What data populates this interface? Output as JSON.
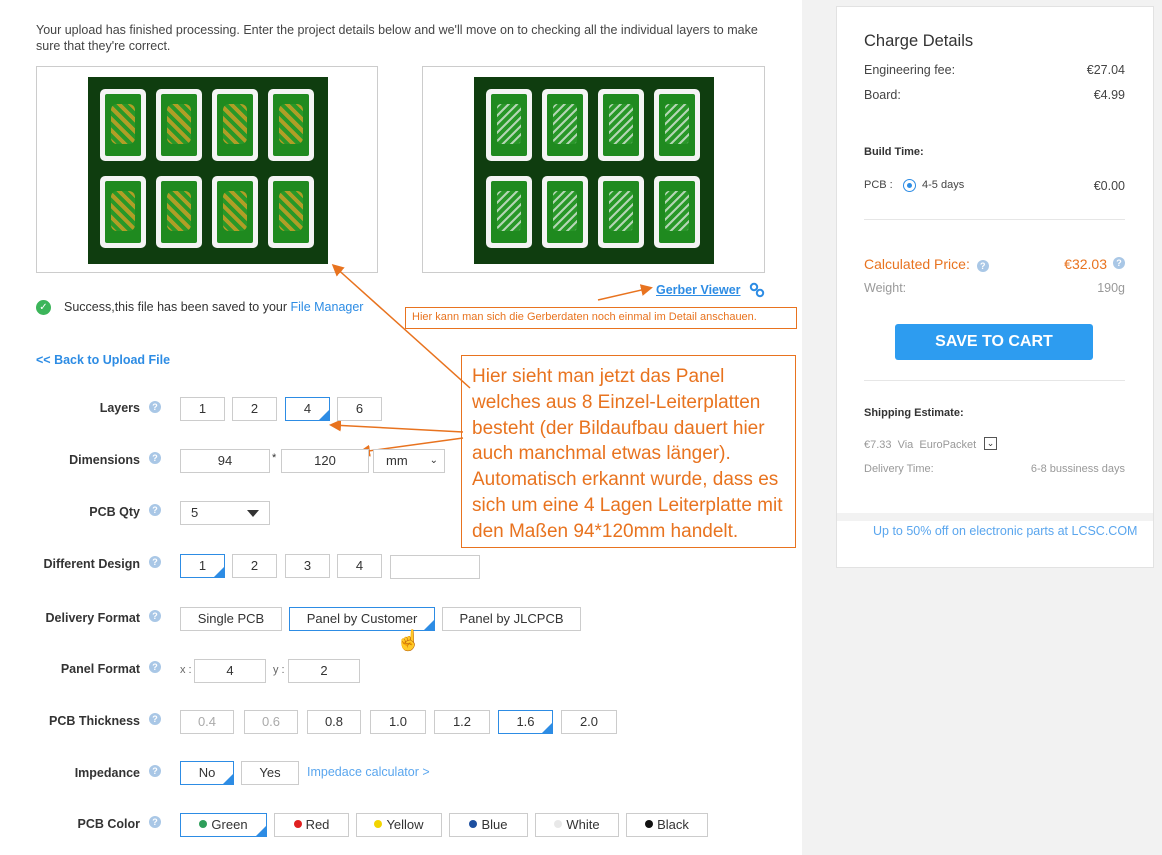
{
  "intro_text": "Your upload has finished processing. Enter the project details below and we'll move on to checking all the individual layers to make sure that they're correct.",
  "gerber_viewer_label": "Gerber Viewer",
  "success": {
    "prefix": "Success,this file has been saved to your ",
    "link": "File Manager"
  },
  "back_link": "<< Back to Upload File",
  "annotations": {
    "gerber_note": "Hier kann man sich die Gerberdaten noch einmal im Detail anschauen.",
    "panel_note": "Hier sieht man jetzt das Panel welches aus 8 Einzel-Leiterplatten besteht (der Bildaufbau dauert hier auch manchmal etwas länger). Automatisch erkannt wurde, dass es sich um eine 4 Lagen Leiterplatte mit den Maßen 94*120mm handelt."
  },
  "form": {
    "layers": {
      "label": "Layers",
      "options": [
        "1",
        "2",
        "4",
        "6"
      ],
      "selected": "4"
    },
    "dimensions": {
      "label": "Dimensions",
      "x": "94",
      "sep": "*",
      "y": "120",
      "unit": "mm"
    },
    "pcb_qty": {
      "label": "PCB Qty",
      "value": "5"
    },
    "different_design": {
      "label": "Different Design",
      "options": [
        "1",
        "2",
        "3",
        "4"
      ],
      "selected": "1",
      "custom": ""
    },
    "delivery_format": {
      "label": "Delivery Format",
      "options": [
        "Single PCB",
        "Panel by Customer",
        "Panel by JLCPCB"
      ],
      "selected": "Panel by Customer"
    },
    "panel_format": {
      "label": "Panel Format",
      "x_label": "x :",
      "x": "4",
      "y_label": "y :",
      "y": "2"
    },
    "pcb_thickness": {
      "label": "PCB Thickness",
      "options": [
        "0.4",
        "0.6",
        "0.8",
        "1.0",
        "1.2",
        "1.6",
        "2.0"
      ],
      "selected": "1.6",
      "disabled": [
        "0.4",
        "0.6"
      ]
    },
    "impedance": {
      "label": "Impedance",
      "options": [
        "No",
        "Yes"
      ],
      "selected": "No",
      "calculator": "Impedace calculator >"
    },
    "pcb_color": {
      "label": "PCB Color",
      "options": [
        {
          "name": "Green",
          "color": "#2e9e5a"
        },
        {
          "name": "Red",
          "color": "#e02020"
        },
        {
          "name": "Yellow",
          "color": "#f2d400"
        },
        {
          "name": "Blue",
          "color": "#1d4fa0"
        },
        {
          "name": "White",
          "color": "#e8e8e8"
        },
        {
          "name": "Black",
          "color": "#111111"
        }
      ],
      "selected": "Green"
    }
  },
  "charges": {
    "title": "Charge Details",
    "engineering_label": "Engineering fee:",
    "engineering_value": "€27.04",
    "board_label": "Board:",
    "board_value": "€4.99",
    "build_time_label": "Build Time:",
    "pcb_label": "PCB :",
    "pcb_option": "4-5 days",
    "pcb_option_price": "€0.00",
    "calc_label": "Calculated Price:",
    "calc_value": "€32.03",
    "weight_label": "Weight:",
    "weight_value": "190g",
    "save_button": "SAVE TO CART",
    "shipping_label": "Shipping Estimate:",
    "shipping_price": "€7.33",
    "shipping_via": "Via",
    "shipping_carrier": "EuroPacket",
    "delivery_label": "Delivery Time:",
    "delivery_value": "6-8 bussiness days",
    "promo": "Up to 50% off on electronic parts at LCSC.COM"
  },
  "colors": {
    "accent": "#2d8ce4",
    "annotation": "#e8731f",
    "price": "#e8731f"
  }
}
